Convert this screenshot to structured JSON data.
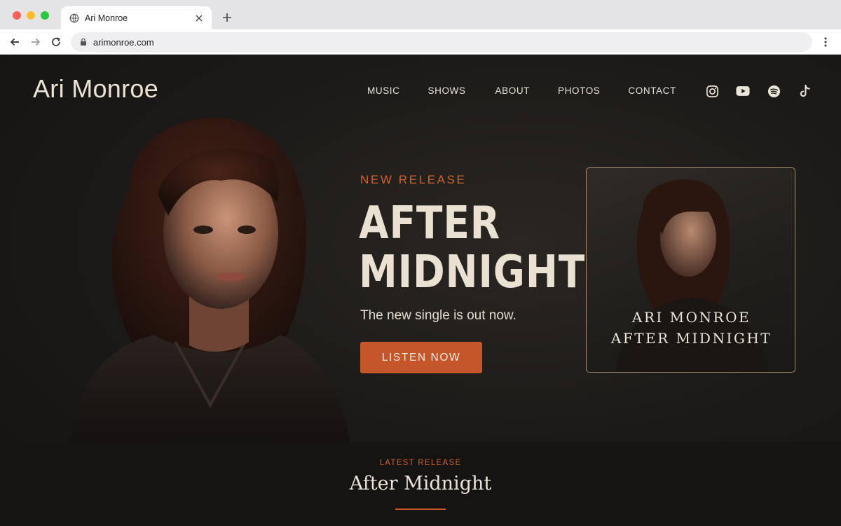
{
  "browser": {
    "tab_title": "Ari Monroe",
    "url": "arimonroe.com"
  },
  "site": {
    "logo": "Ari Monroe",
    "nav": [
      "MUSIC",
      "SHOWS",
      "ABOUT",
      "PHOTOS",
      "CONTACT"
    ],
    "socials": [
      "instagram-icon",
      "youtube-icon",
      "spotify-icon",
      "tiktok-icon"
    ]
  },
  "hero": {
    "eyebrow": "NEW RELEASE",
    "title_line1": "AFTER",
    "title_line2": "MIDNIGHT",
    "subtitle": "The new single is out now.",
    "cta_label": "LISTEN NOW"
  },
  "album": {
    "artist": "ARI MONROE",
    "title": "AFTER MIDNIGHT"
  },
  "latest": {
    "eyebrow": "LATEST RELEASE",
    "title": "After Midnight"
  },
  "colors": {
    "accent": "#c4562a",
    "accent_text": "#d2622c",
    "background": "#1d1b19",
    "text_light": "#ebe1d2"
  }
}
